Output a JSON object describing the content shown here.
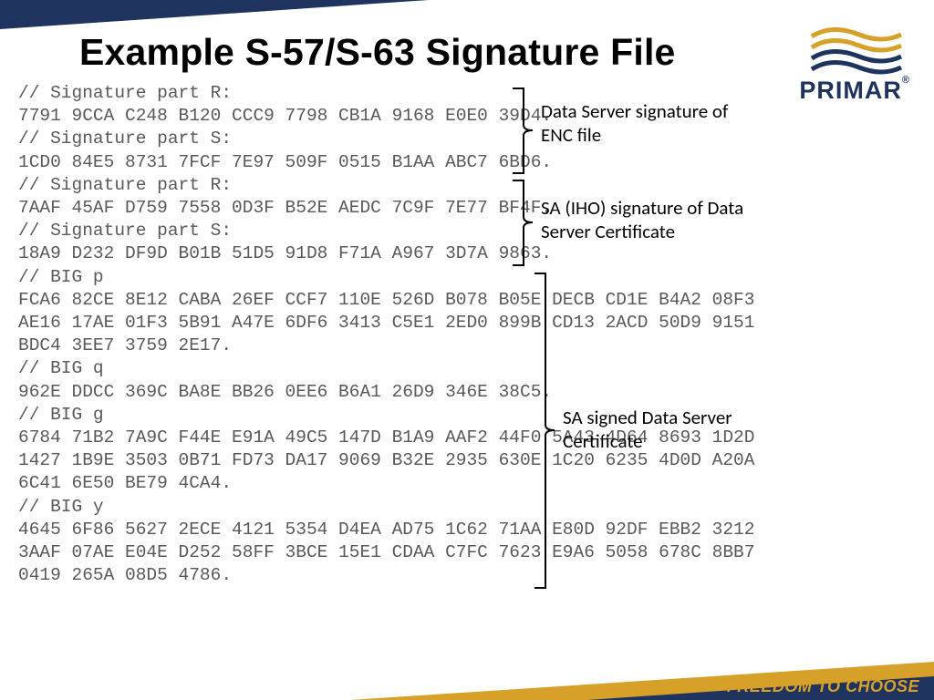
{
  "title": "Example S-57/S-63 Signature File",
  "logo_text": "PRIMAR",
  "logo_trademark": "®",
  "tagline": "FREEDOM TO CHOOSE",
  "annotations": {
    "anno1": "Data Server signature of ENC file",
    "anno2": "SA (IHO) signature of Data Server Certificate",
    "anno3": "SA signed Data Server Certificate"
  },
  "code_lines": [
    "// Signature part R:",
    "7791 9CCA C248 B120 CCC9 7798 CB1A 9168 E0E0 39D4.",
    "// Signature part S:",
    "1CD0 84E5 8731 7FCF 7E97 509F 0515 B1AA ABC7 6BD6.",
    "// Signature part R:",
    "7AAF 45AF D759 7558 0D3F B52E AEDC 7C9F 7E77 BF4F.",
    "// Signature part S:",
    "18A9 D232 DF9D B01B 51D5 91D8 F71A A967 3D7A 9863.",
    "// BIG p",
    "FCA6 82CE 8E12 CABA 26EF CCF7 110E 526D B078 B05E DECB CD1E B4A2 08F3",
    "AE16 17AE 01F3 5B91 A47E 6DF6 3413 C5E1 2ED0 899B CD13 2ACD 50D9 9151",
    "BDC4 3EE7 3759 2E17.",
    "// BIG q",
    "962E DDCC 369C BA8E BB26 0EE6 B6A1 26D9 346E 38C5.",
    "// BIG g",
    "6784 71B2 7A9C F44E E91A 49C5 147D B1A9 AAF2 44F0 5A43 4D64 8693 1D2D",
    "1427 1B9E 3503 0B71 FD73 DA17 9069 B32E 2935 630E 1C20 6235 4D0D A20A",
    "6C41 6E50 BE79 4CA4.",
    "// BIG y",
    "4645 6F86 5627 2ECE 4121 5354 D4EA AD75 1C62 71AA E80D 92DF EBB2 3212",
    "3AAF 07AE E04E D252 58FF 3BCE 15E1 CDAA C7FC 7623 E9A6 5058 678C 8BB7",
    "0419 265A 08D5 4786."
  ]
}
